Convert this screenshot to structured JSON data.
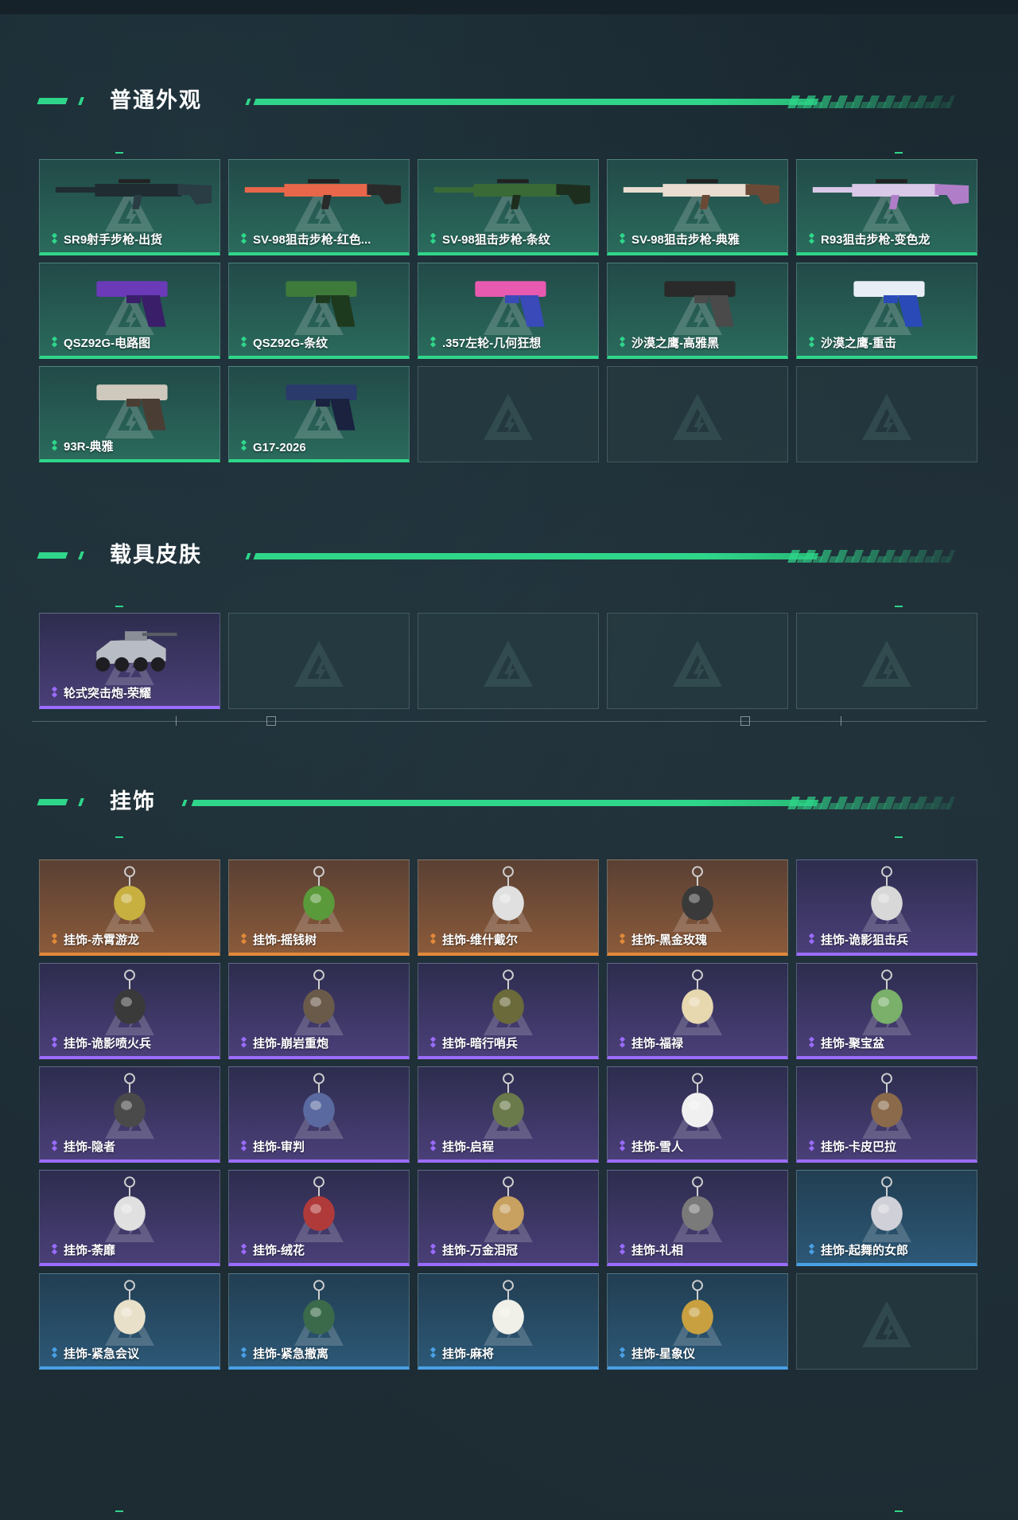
{
  "sections": [
    {
      "title": "普通外观",
      "items": [
        {
          "label": "SR9射手步枪-出货",
          "rarity": "green",
          "art": "rifle-dark-icon"
        },
        {
          "label": "SV-98狙击步枪-红色...",
          "rarity": "green",
          "art": "sniper-red-icon"
        },
        {
          "label": "SV-98狙击步枪-条纹",
          "rarity": "green",
          "art": "sniper-camo-icon"
        },
        {
          "label": "SV-98狙击步枪-典雅",
          "rarity": "green",
          "art": "sniper-white-icon"
        },
        {
          "label": "R93狙击步枪-变色龙",
          "rarity": "green",
          "art": "sniper-pink-icon"
        },
        {
          "label": "QSZ92G-电路图",
          "rarity": "green",
          "art": "pistol-purple-icon"
        },
        {
          "label": "QSZ92G-条纹",
          "rarity": "green",
          "art": "pistol-camo-icon"
        },
        {
          "label": ".357左轮-几何狂想",
          "rarity": "green",
          "art": "revolver-pink-icon"
        },
        {
          "label": "沙漠之鹰-高雅黑",
          "rarity": "green",
          "art": "pistol-black-icon"
        },
        {
          "label": "沙漠之鹰-重击",
          "rarity": "green",
          "art": "pistol-white-blue-icon"
        },
        {
          "label": "93R-典雅",
          "rarity": "green",
          "art": "pistol-silver-icon"
        },
        {
          "label": "G17-2026",
          "rarity": "green",
          "art": "pistol-navy-icon"
        },
        {
          "label": "",
          "rarity": "empty"
        },
        {
          "label": "",
          "rarity": "empty"
        },
        {
          "label": "",
          "rarity": "empty"
        }
      ]
    },
    {
      "title": "载具皮肤",
      "items": [
        {
          "label": "轮式突击炮-荣耀",
          "rarity": "purple",
          "art": "vehicle-icon"
        },
        {
          "label": "",
          "rarity": "empty"
        },
        {
          "label": "",
          "rarity": "empty"
        },
        {
          "label": "",
          "rarity": "empty"
        },
        {
          "label": "",
          "rarity": "empty"
        }
      ]
    },
    {
      "title": "挂饰",
      "items": [
        {
          "label": "挂饰-赤霄游龙",
          "rarity": "orange",
          "art": "charm-icon"
        },
        {
          "label": "挂饰-摇钱树",
          "rarity": "orange",
          "art": "charm-icon"
        },
        {
          "label": "挂饰-维什戴尔",
          "rarity": "orange",
          "art": "charm-icon"
        },
        {
          "label": "挂饰-黑金玫瑰",
          "rarity": "orange",
          "art": "charm-icon"
        },
        {
          "label": "挂饰-诡影狙击兵",
          "rarity": "purple",
          "art": "charm-icon"
        },
        {
          "label": "挂饰-诡影喷火兵",
          "rarity": "purple",
          "art": "charm-icon"
        },
        {
          "label": "挂饰-崩岩重炮",
          "rarity": "purple",
          "art": "charm-icon"
        },
        {
          "label": "挂饰-暗行哨兵",
          "rarity": "purple",
          "art": "charm-icon"
        },
        {
          "label": "挂饰-福禄",
          "rarity": "purple",
          "art": "charm-icon"
        },
        {
          "label": "挂饰-聚宝盆",
          "rarity": "purple",
          "art": "charm-icon"
        },
        {
          "label": "挂饰-隐者",
          "rarity": "purple",
          "art": "charm-icon"
        },
        {
          "label": "挂饰-审判",
          "rarity": "purple",
          "art": "charm-icon"
        },
        {
          "label": "挂饰-启程",
          "rarity": "purple",
          "art": "charm-icon"
        },
        {
          "label": "挂饰-雪人",
          "rarity": "purple",
          "art": "charm-icon"
        },
        {
          "label": "挂饰-卡皮巴拉",
          "rarity": "purple",
          "art": "charm-icon"
        },
        {
          "label": "挂饰-荼靡",
          "rarity": "purple",
          "art": "charm-icon"
        },
        {
          "label": "挂饰-绒花",
          "rarity": "purple",
          "art": "charm-icon"
        },
        {
          "label": "挂饰-万金泪冠",
          "rarity": "purple",
          "art": "charm-icon"
        },
        {
          "label": "挂饰-礼相",
          "rarity": "purple",
          "art": "charm-icon"
        },
        {
          "label": "挂饰-起舞的女郎",
          "rarity": "blue",
          "art": "charm-icon"
        },
        {
          "label": "挂饰-紧急会议",
          "rarity": "blue",
          "art": "charm-icon"
        },
        {
          "label": "挂饰-紧急撤离",
          "rarity": "blue",
          "art": "charm-icon"
        },
        {
          "label": "挂饰-麻将",
          "rarity": "blue",
          "art": "charm-icon"
        },
        {
          "label": "挂饰-星象仪",
          "rarity": "blue",
          "art": "charm-icon"
        },
        {
          "label": "",
          "rarity": "empty"
        }
      ]
    }
  ],
  "colors": {
    "accent": "#2fd68a",
    "green": "#2fd68a",
    "purple": "#9b6cff",
    "orange": "#e2893a",
    "blue": "#4aa0e6"
  }
}
